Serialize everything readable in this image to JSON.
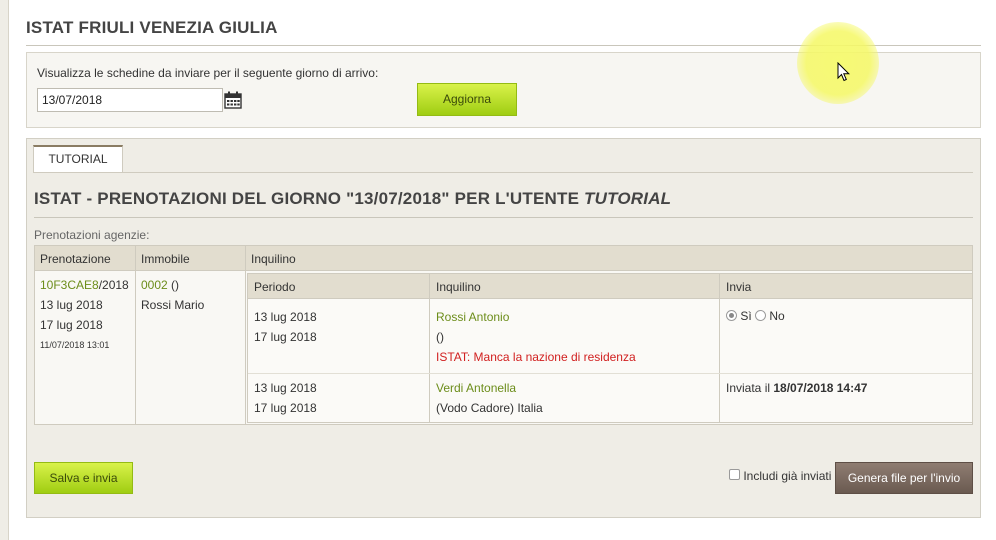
{
  "page": {
    "title": "ISTAT FRIULI VENEZIA GIULIA"
  },
  "filter": {
    "label": "Visualizza le schedine da inviare per il seguente giorno di arrivo:",
    "date_value": "13/07/2018",
    "update_button": "Aggiorna"
  },
  "tabs": [
    {
      "label": "TUTORIAL",
      "active": true
    }
  ],
  "section": {
    "title_prefix": "ISTAT - PRENOTAZIONI DEL GIORNO \"13/07/2018\" PER L'UTENTE ",
    "title_user": "TUTORIAL",
    "agency_label": "Prenotazioni agenzie:"
  },
  "table": {
    "headers": [
      "Prenotazione",
      "Immobile",
      "Inquilino"
    ],
    "booking": {
      "code": "10F3CAE8",
      "year_suffix": "/2018",
      "date_from": "13 lug 2018",
      "date_to": "17 lug 2018",
      "created": "11/07/2018 13:01"
    },
    "property": {
      "code": "0002",
      "code_suffix": " ()",
      "owner": "Rossi Mario"
    },
    "inner_headers": [
      "Periodo",
      "Inquilino",
      "Invia"
    ],
    "tenants": [
      {
        "period_from": "13 lug 2018",
        "period_to": "17 lug 2018",
        "name": "Rossi Antonio",
        "detail": "()",
        "error": "ISTAT: Manca la nazione di residenza",
        "send_yes": "Sì",
        "send_no": "No",
        "send_selected": "yes"
      },
      {
        "period_from": "13 lug 2018",
        "period_to": "17 lug 2018",
        "name": "Verdi Antonella",
        "detail": "(Vodo Cadore) Italia",
        "sent_label": "Inviata il ",
        "sent_date": "18/07/2018 14:47"
      }
    ]
  },
  "actions": {
    "save_send": "Salva e invia",
    "include_sent": "Includi già inviati",
    "generate": "Genera file per l'invio"
  },
  "colors": {
    "accent_green": "#9fcd12",
    "link_green": "#6c8d1a",
    "error_red": "#d12020",
    "generate_brown": "#6a5a50",
    "panel_bg": "#efede6"
  }
}
